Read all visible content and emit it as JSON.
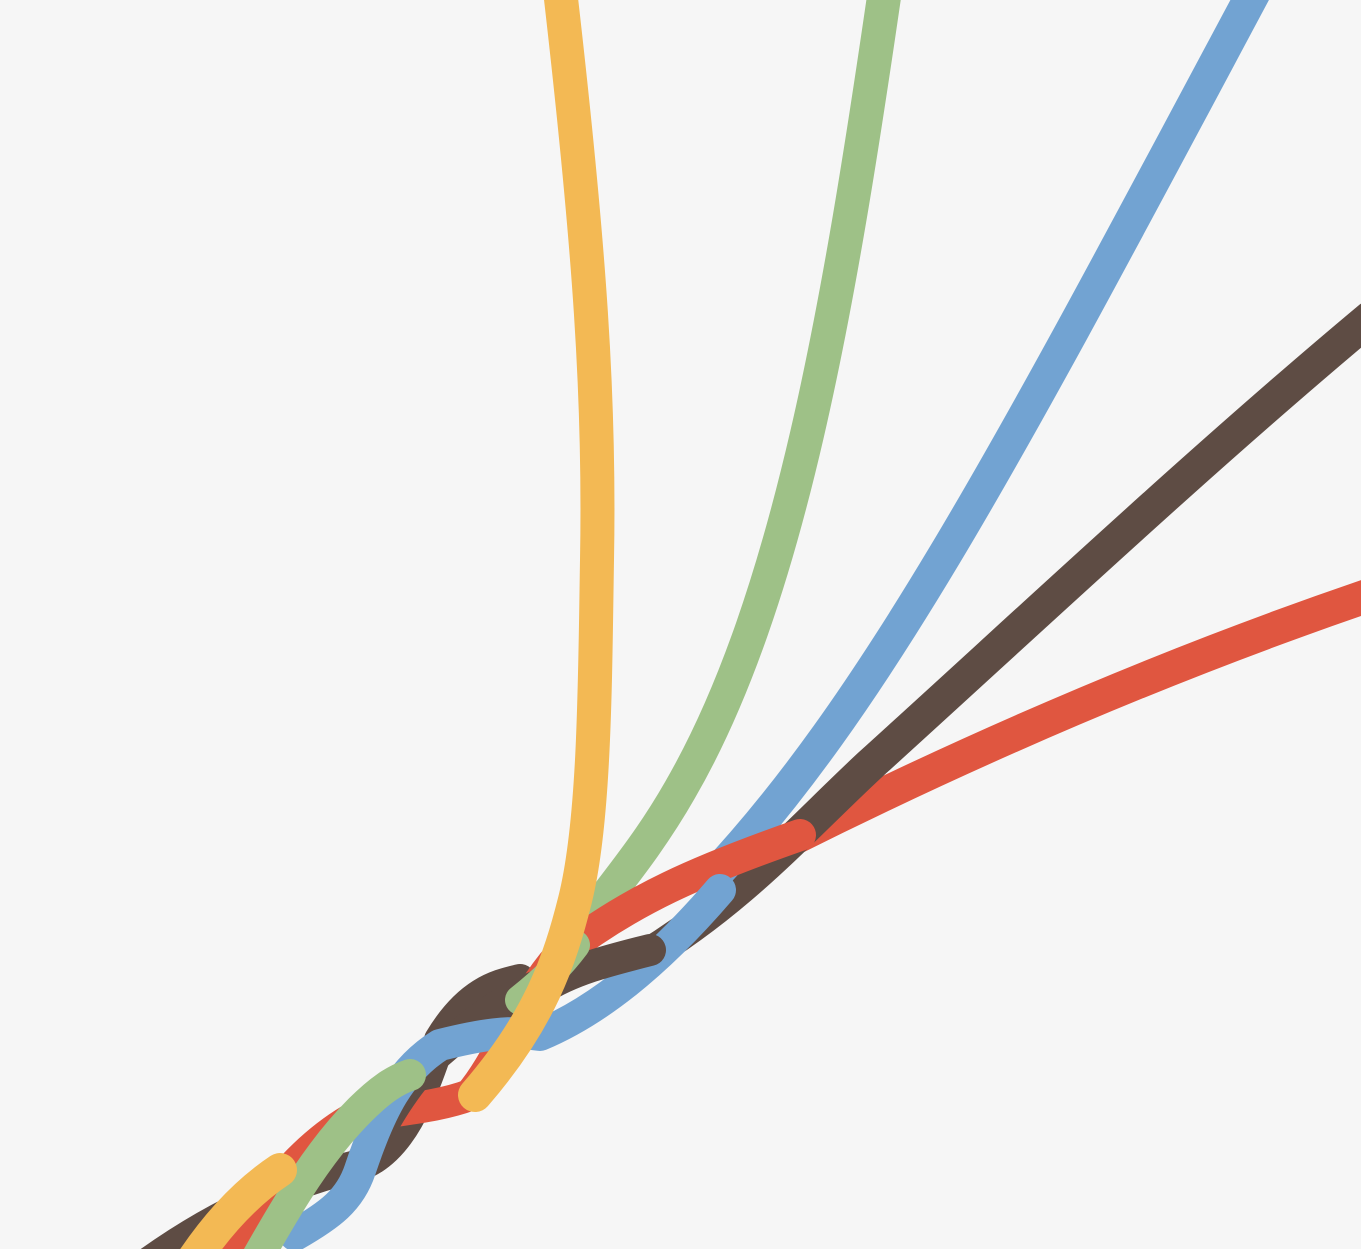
{
  "background": "#f6f6f6",
  "strands": [
    {
      "name": "brown-strand",
      "color": "#5e4c44"
    },
    {
      "name": "red-strand",
      "color": "#e05640"
    },
    {
      "name": "blue-strand",
      "color": "#72a3d2"
    },
    {
      "name": "green-strand",
      "color": "#9ec187"
    },
    {
      "name": "yellow-strand",
      "color": "#f3b954"
    }
  ]
}
